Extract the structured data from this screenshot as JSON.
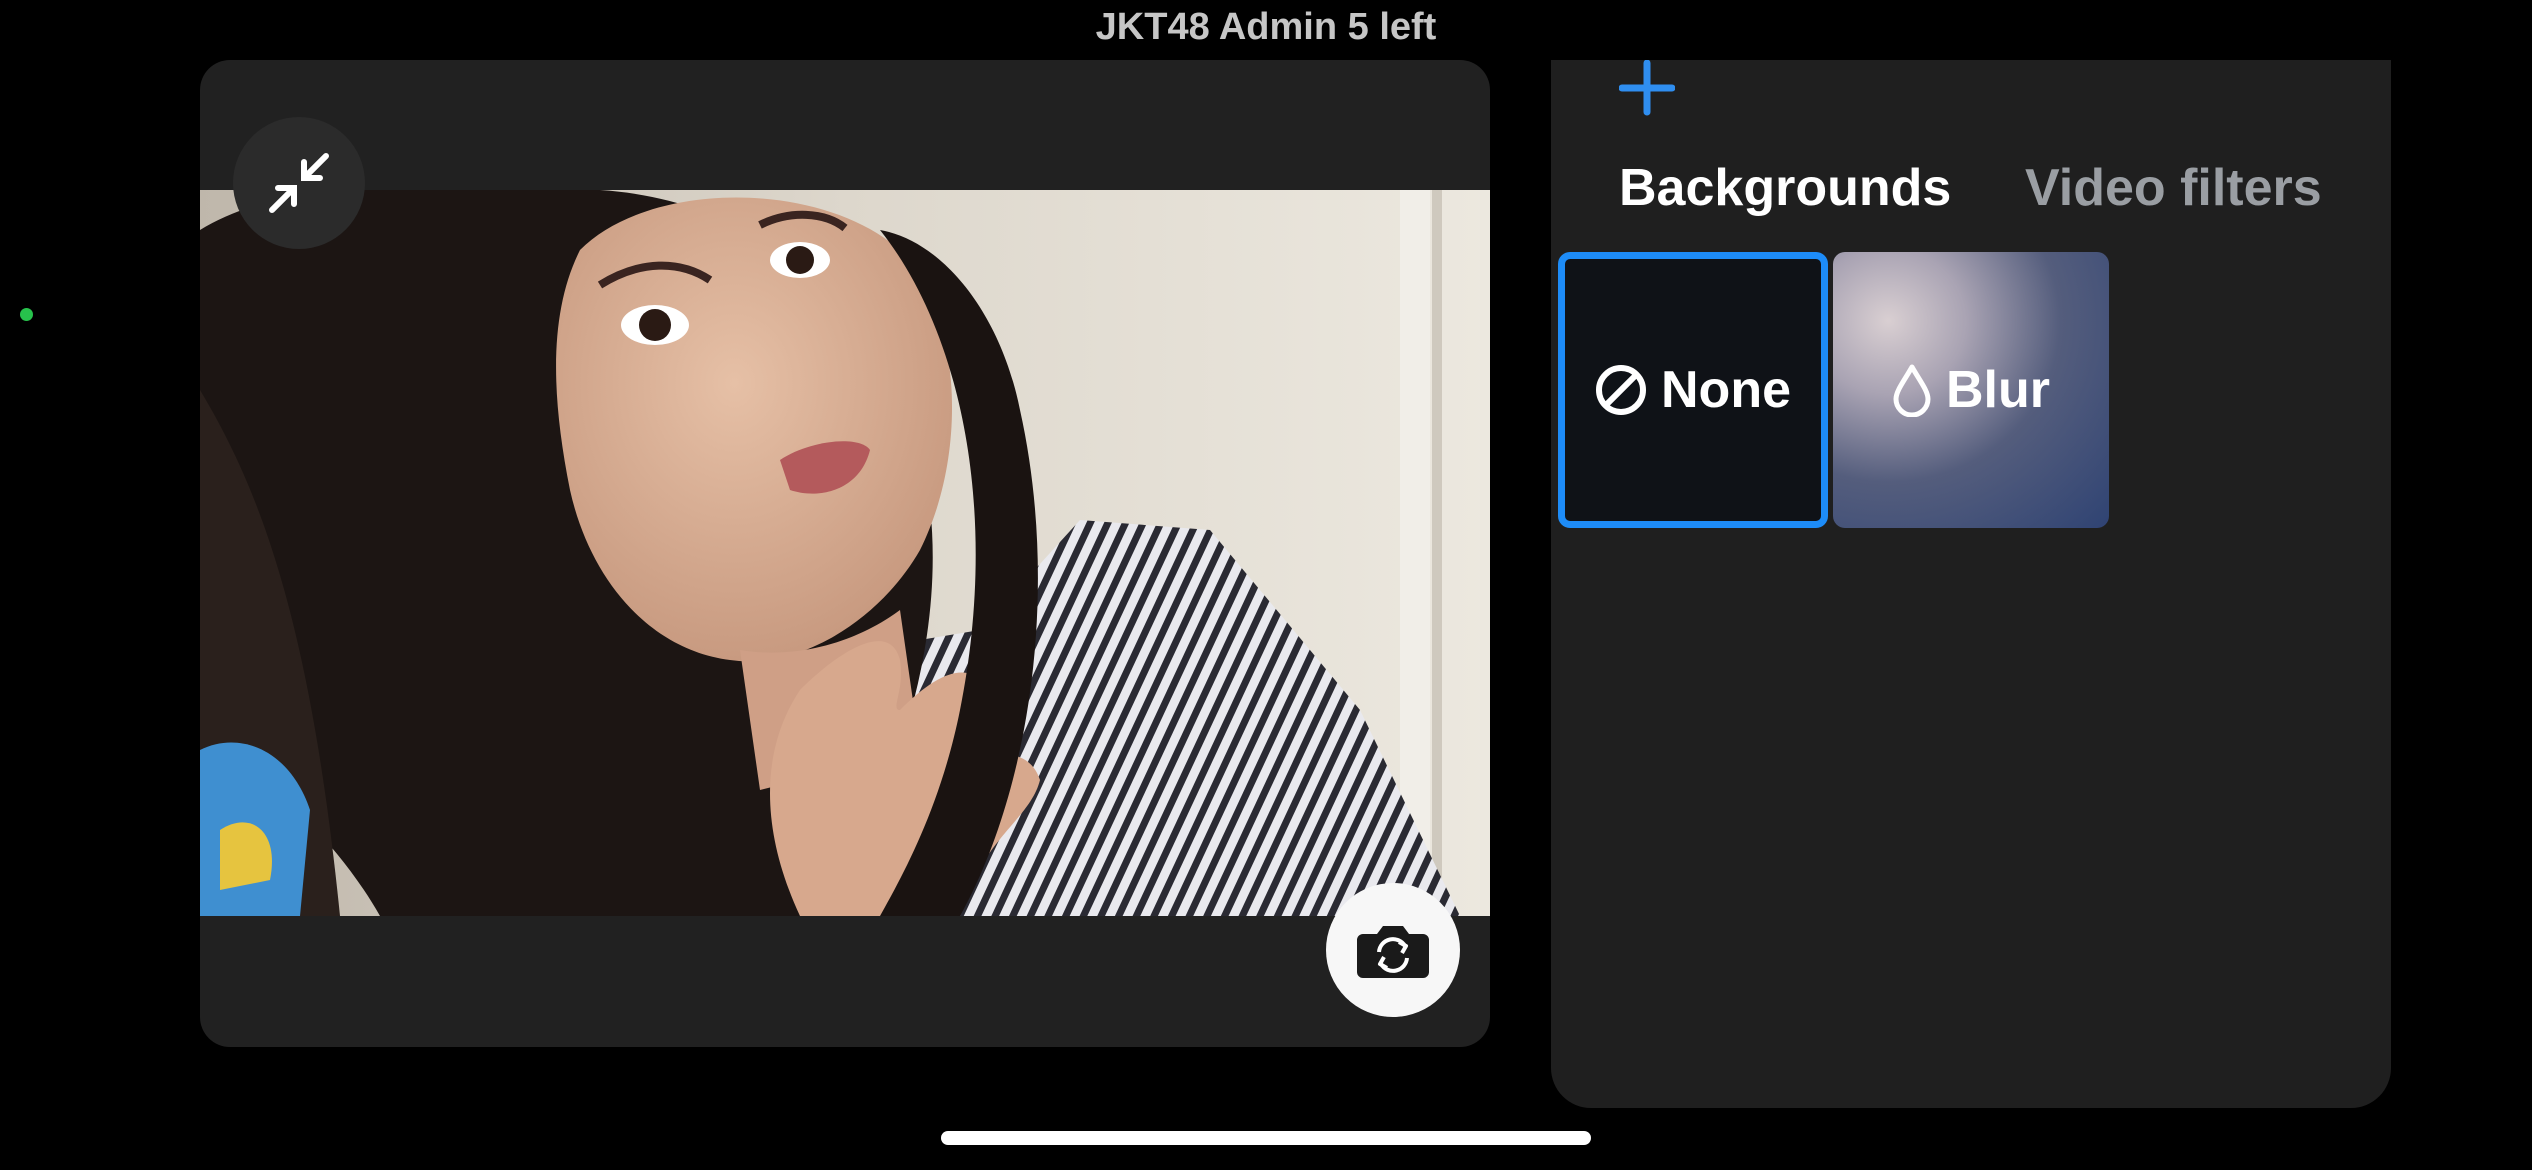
{
  "header": {
    "title": "JKT48 Admin 5 left"
  },
  "preview": {
    "collapse_icon": "collapse-arrows-icon",
    "flip_camera_icon": "camera-flip-icon"
  },
  "effects": {
    "add_icon": "plus-icon",
    "tabs": [
      {
        "label": "Backgrounds",
        "selected": true
      },
      {
        "label": "Video filters",
        "selected": false
      }
    ],
    "options": [
      {
        "label": "None",
        "icon": "prohibited-icon",
        "selected": true
      },
      {
        "label": "Blur",
        "icon": "droplet-icon",
        "selected": false
      }
    ]
  },
  "colors": {
    "accent": "#1d8cf8",
    "panel": "#1f1f1f",
    "card": "#212121",
    "status_dot": "#27c24c"
  }
}
